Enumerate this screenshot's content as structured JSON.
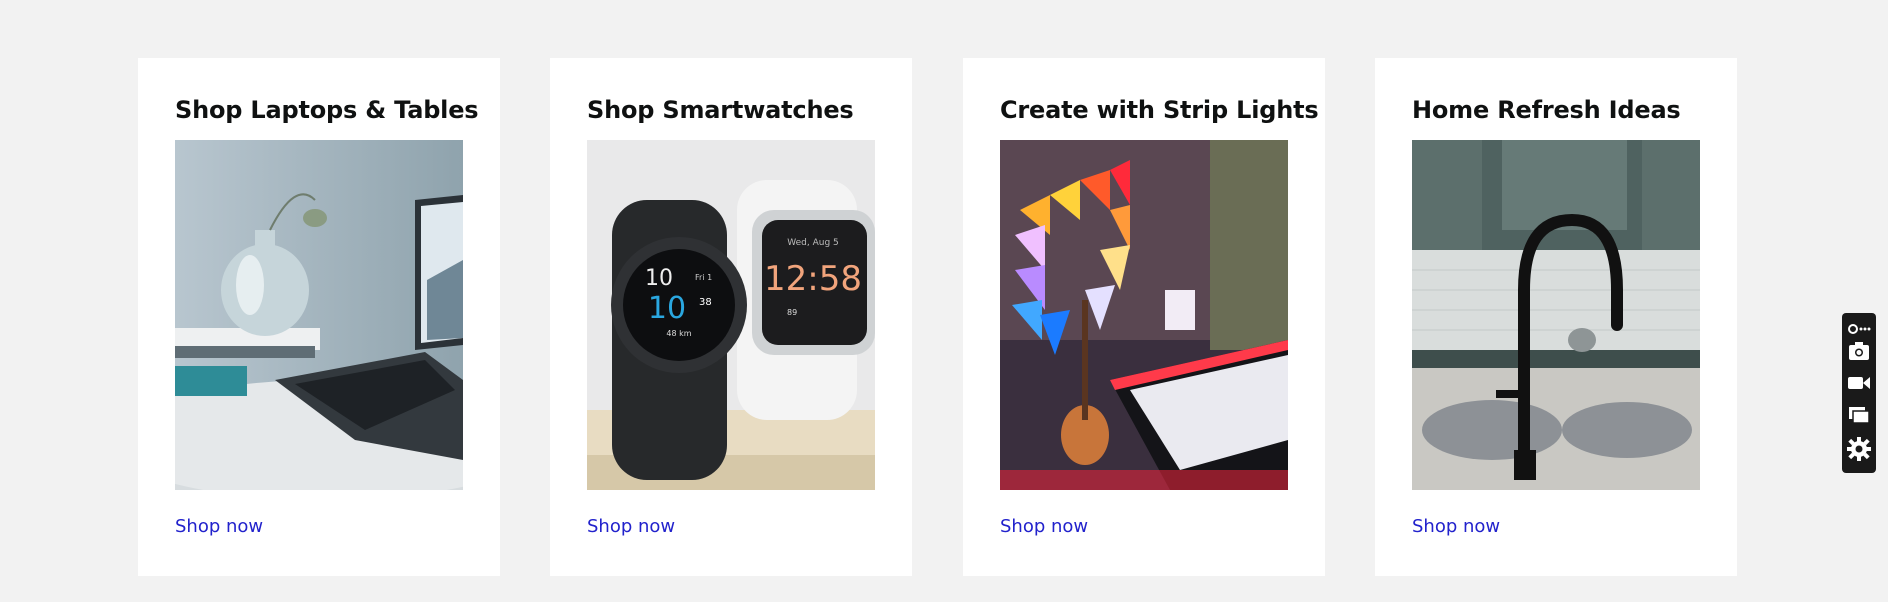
{
  "cards": [
    {
      "title": "Shop Laptops & Tables",
      "link": "Shop now",
      "image": "laptop-vase-photo"
    },
    {
      "title": "Shop Smartwatches",
      "link": "Shop now",
      "image": "smartwatches-photo"
    },
    {
      "title": "Create with Strip Lights",
      "link": "Shop now",
      "image": "strip-lights-photo"
    },
    {
      "title": "Home Refresh Ideas",
      "link": "Shop now",
      "image": "kitchen-faucet-photo"
    }
  ],
  "smartwatch_faces": {
    "black_hour": "10",
    "black_day": "Fri 1",
    "black_time": "10",
    "black_seconds": "38",
    "black_distance": "48 km",
    "white_date": "Wed, Aug 5",
    "white_time": "12:58",
    "white_stat": "89"
  },
  "toolbar": {
    "icons": [
      "settings-icon",
      "screenshot-icon",
      "video-icon",
      "windows-icon",
      "gear-icon"
    ]
  },
  "colors": {
    "page_bg": "#f2f2f2",
    "card_bg": "#ffffff",
    "link": "#2222cc",
    "title": "#0f1111"
  }
}
